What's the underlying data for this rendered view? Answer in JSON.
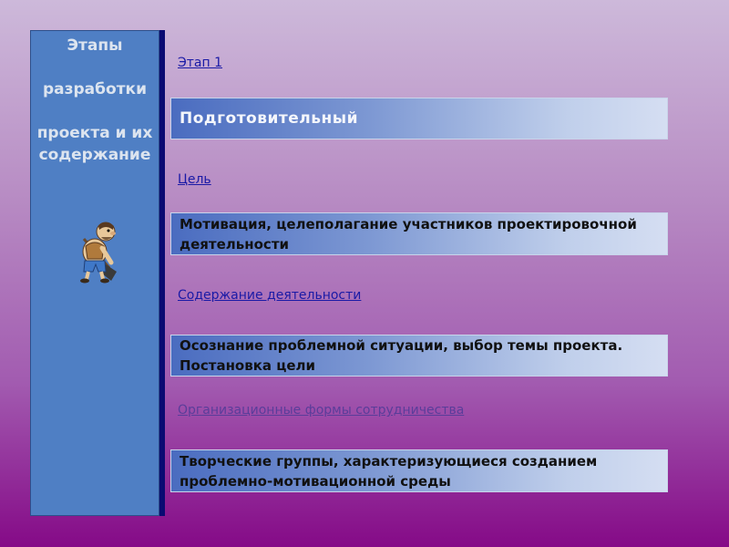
{
  "sidebar": {
    "title_line1": "Этапы",
    "title_line2": "разработки",
    "title_line3": "проекта и их содержание"
  },
  "stage": {
    "link": "Этап 1",
    "value": "Подготовительный"
  },
  "goal": {
    "link": "Цель",
    "value": "Мотивация, целеполагание участников проектировочной деятельности"
  },
  "content": {
    "link": "Содержание деятельности",
    "value": "Осознание проблемной ситуации, выбор темы проекта. Постановка цели"
  },
  "forms": {
    "link": "Организационные формы сотрудничества",
    "value": "Творческие группы, характеризующиеся созданием проблемно-мотивационной среды"
  },
  "colors": {
    "sidebar": "#4f7fc4",
    "sidebar_rule": "#0a0a72",
    "link": "#1a1aa6"
  }
}
